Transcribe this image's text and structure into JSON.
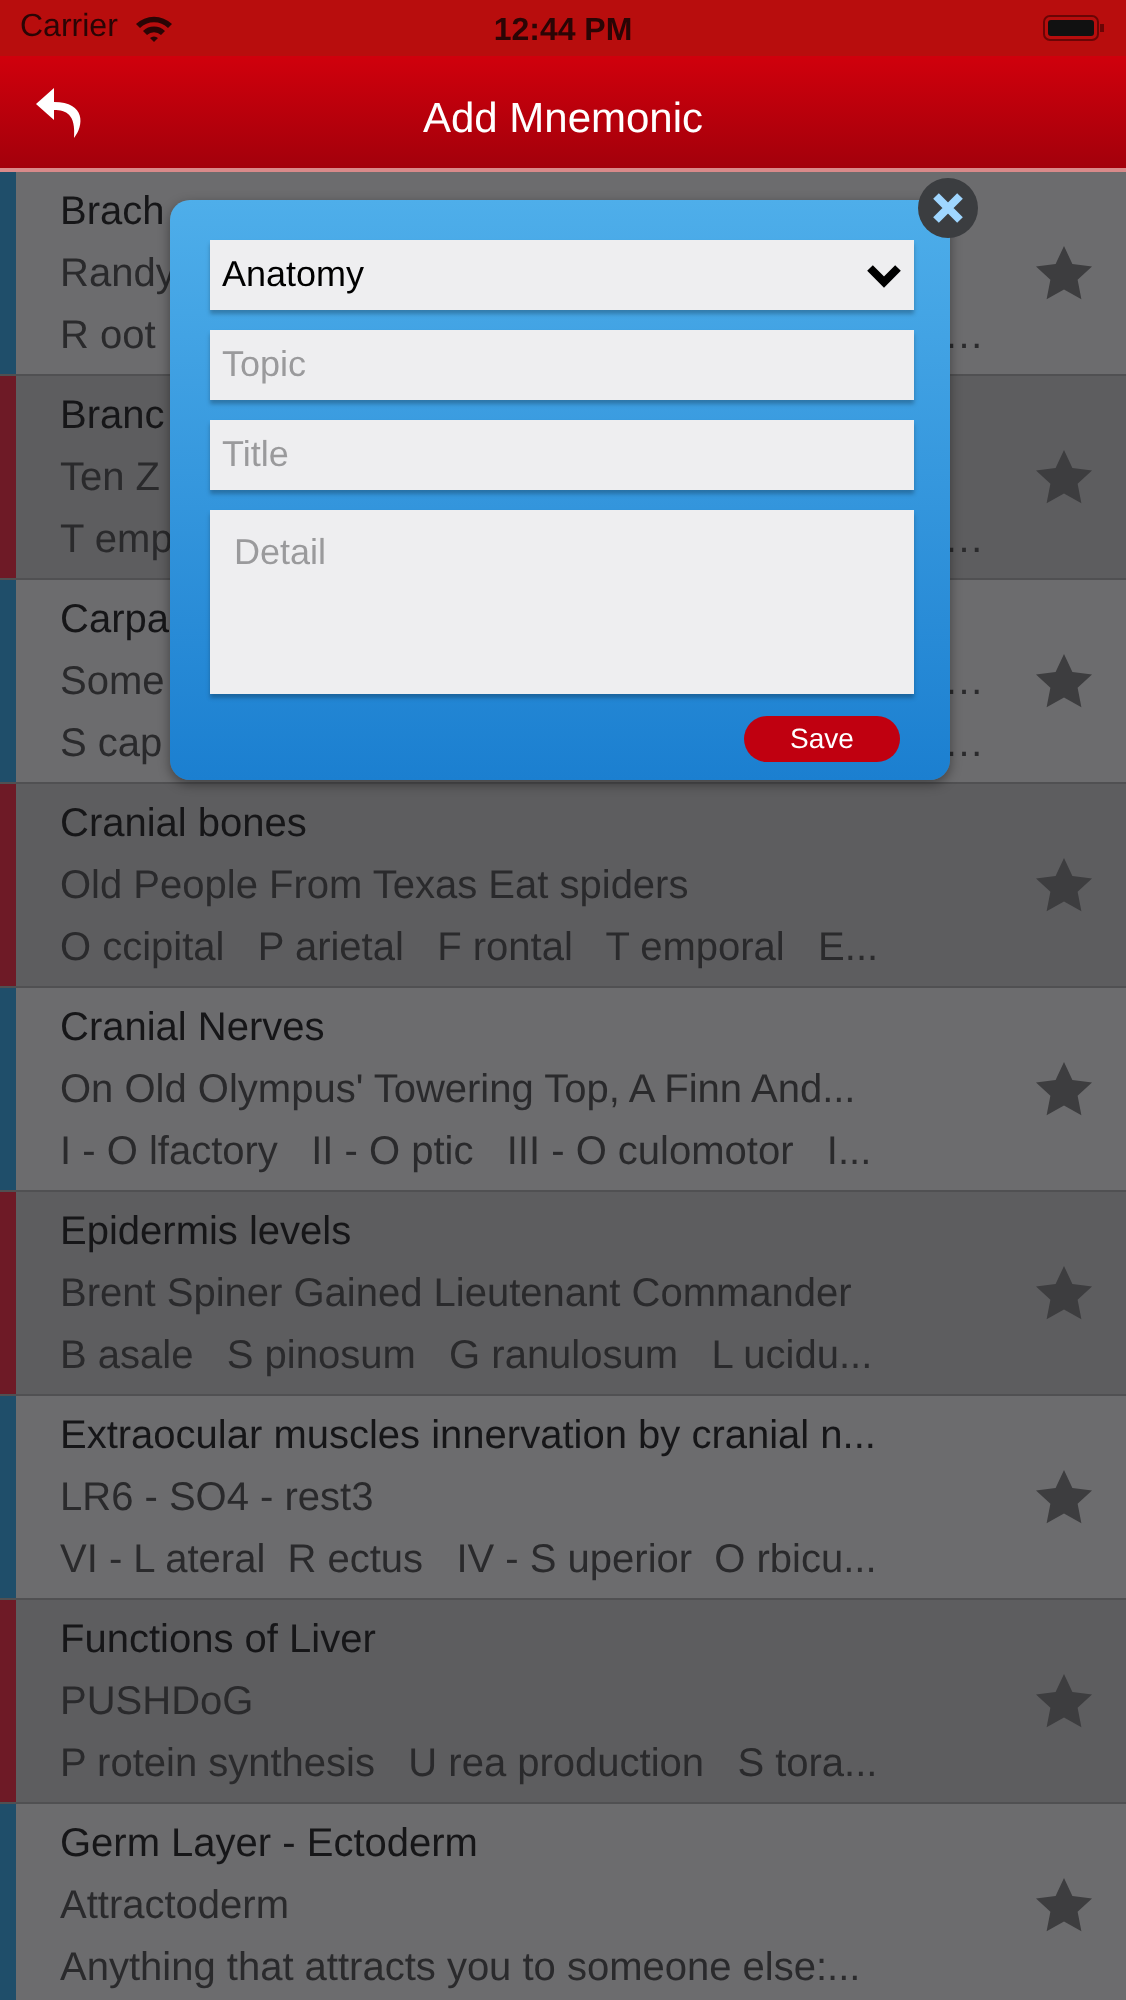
{
  "status_bar": {
    "carrier": "Carrier",
    "time": "12:44 PM"
  },
  "nav_bar": {
    "title": "Add Mnemonic"
  },
  "list": [
    {
      "color": "#1f4e6a",
      "title": "Brach",
      "line_1": "Randy",
      "line_2": "R oot",
      "tail_2": "…"
    },
    {
      "color": "#6e1a26",
      "title": "Branc",
      "line_1": "Ten Z",
      "line_2": "T emp",
      "tail_2": "…"
    },
    {
      "color": "#1f4e6a",
      "title": "Carpa",
      "line_1": "Some",
      "tail_1": "…",
      "line_2": "S cap",
      "tail_2": "…"
    },
    {
      "color": "#6e1a26",
      "title": "Cranial bones",
      "line_1": "Old People From Texas Eat spiders",
      "line_2": "O ccipital   P arietal   F rontal   T emporal   E..."
    },
    {
      "color": "#1f4e6a",
      "title": "Cranial Nerves",
      "line_1": "On Old Olympus' Towering Top, A Finn And...",
      "line_2": "I - O lfactory   II - O ptic   III - O culomotor   I..."
    },
    {
      "color": "#6e1a26",
      "title": "Epidermis levels",
      "line_1": "Brent Spiner Gained Lieutenant Commander",
      "line_2": "B asale   S pinosum   G ranulosum   L ucidu..."
    },
    {
      "color": "#1f4e6a",
      "title": "Extraocular muscles innervation by cranial n...",
      "line_1": "LR6 - SO4 - rest3",
      "line_2": "VI - L ateral  R ectus   IV - S uperior  O rbicu..."
    },
    {
      "color": "#6e1a26",
      "title": "Functions of Liver",
      "line_1": "PUSHDoG",
      "line_2": "P rotein synthesis   U rea production   S tora..."
    },
    {
      "color": "#1f4e6a",
      "title": "Germ Layer - Ectoderm",
      "line_1": "Attractoderm",
      "line_2": "Anything that attracts you to someone else:..."
    }
  ],
  "dialog": {
    "category": "Anatomy",
    "topic_placeholder": "Topic",
    "title_placeholder": "Title",
    "detail_placeholder": "Detail",
    "save": "Save"
  }
}
